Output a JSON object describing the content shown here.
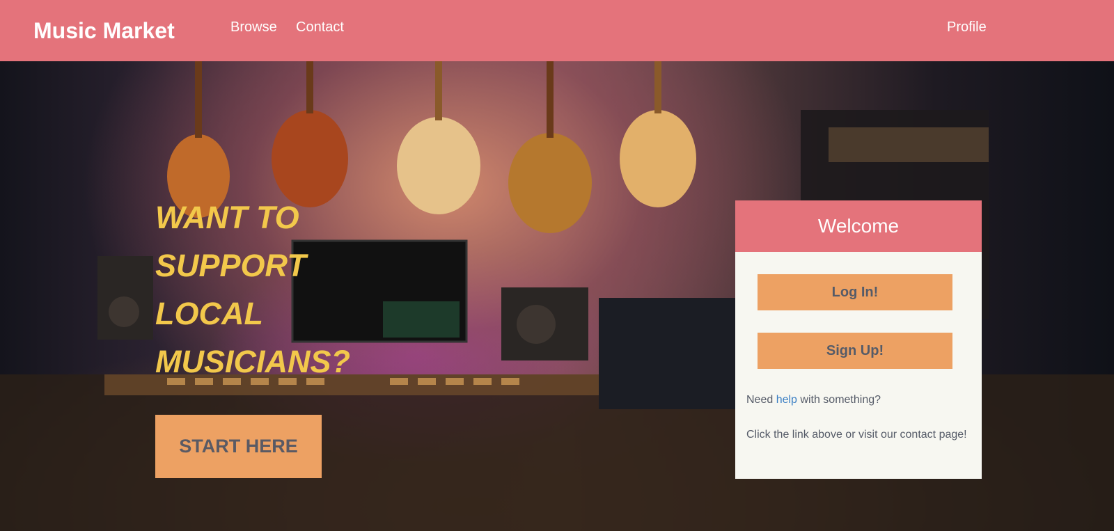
{
  "navbar": {
    "brand": "Music Market",
    "links": [
      "Browse",
      "Contact"
    ],
    "profile": "Profile",
    "background_color": "#e4737b"
  },
  "hero": {
    "headline_lines": [
      "WANT TO",
      "SUPPORT",
      "LOCAL",
      "MUSICIANS?"
    ],
    "cta_label": "START HERE",
    "headline_color": "#f2c84b",
    "cta_color": "#eda163"
  },
  "welcome_card": {
    "title": "Welcome",
    "login_label": "Log In!",
    "signup_label": "Sign Up!",
    "help_prefix": "Need ",
    "help_link": "help",
    "help_suffix": " with something?",
    "contact_text": "Click the link above or visit our contact page!"
  }
}
